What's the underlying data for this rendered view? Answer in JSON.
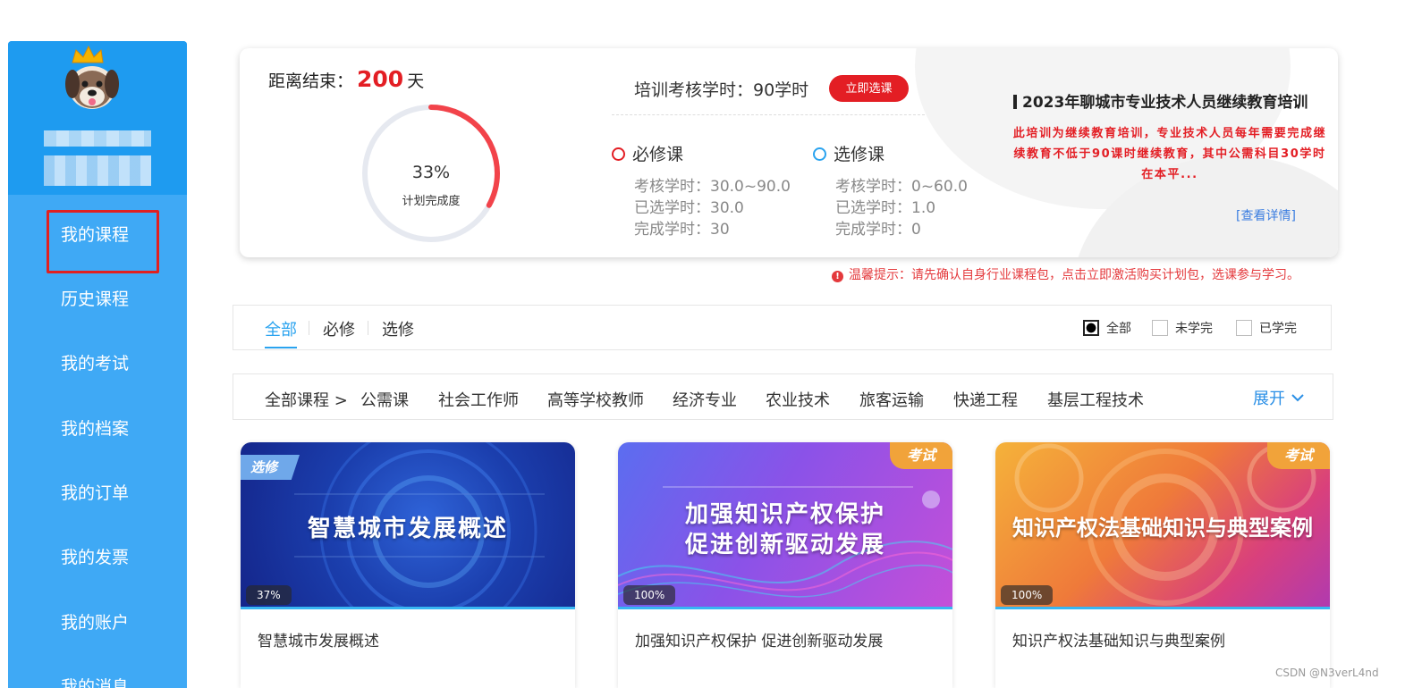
{
  "sidebar": {
    "items": [
      {
        "label": "我的课程"
      },
      {
        "label": "历史课程"
      },
      {
        "label": "我的考试"
      },
      {
        "label": "我的档案"
      },
      {
        "label": "我的订单"
      },
      {
        "label": "我的发票"
      },
      {
        "label": "我的账户"
      },
      {
        "label": "我的消息"
      }
    ]
  },
  "stats": {
    "countdown_prefix": "距离结束：",
    "countdown_value": "200",
    "countdown_unit": "天",
    "completion_percent": "33%",
    "completion_value": 0.33,
    "completion_label": "计划完成度",
    "hours_title": "培训考核学时：90学时",
    "select_button": "立即选课",
    "required": {
      "title": "必修课",
      "assess": "考核学时：30.0~90.0",
      "selected": "已选学时：30.0",
      "completed": "完成学时：30"
    },
    "elective": {
      "title": "选修课",
      "assess": "考核学时：0~60.0",
      "selected": "已选学时：1.0",
      "completed": "完成学时：0"
    },
    "intro_title": "2023年聊城市专业技术人员继续教育培训",
    "intro_text": "此培训为继续教育培训，专业技术人员每年需要完成继续教育不低于90课时继续教育，其中公需科目30学时在本平...",
    "detail_link": "[查看详情]"
  },
  "tip": {
    "text": "温馨提示：请先确认自身行业课程包，点击立即激活购买计划包，选课参与学习。"
  },
  "filter": {
    "tabs": [
      "全部",
      "必修",
      "选修"
    ],
    "active_tab": "全部",
    "checks": [
      {
        "label": "全部",
        "checked": true
      },
      {
        "label": "未学完",
        "checked": false
      },
      {
        "label": "已学完",
        "checked": false
      }
    ]
  },
  "categories": {
    "all_label": "全部课程 >",
    "items": [
      "公需课",
      "社会工作师",
      "高等学校教师",
      "经济专业",
      "农业技术",
      "旅客运输",
      "快递工程",
      "基层工程技术"
    ],
    "expand_label": "展开"
  },
  "courses": [
    {
      "cover_title": "智慧城市发展概述",
      "tag": "选修",
      "progress": "37%",
      "name": "智慧城市发展概述"
    },
    {
      "cover_title_line1": "加强知识产权保护",
      "cover_title_line2": "促进创新驱动发展",
      "tag": "考试",
      "progress": "100%",
      "name": "加强知识产权保护 促进创新驱动发展"
    },
    {
      "cover_title": "知识产权法基础知识与典型案例",
      "tag": "考试",
      "progress": "100%",
      "name": "知识产权法基础知识与典型案例"
    }
  ],
  "watermark": "CSDN @N3verL4nd",
  "colors": {
    "sidebar": "#3fa9f5",
    "accent_red": "#e31e24",
    "accent_blue": "#2aa3ef"
  }
}
